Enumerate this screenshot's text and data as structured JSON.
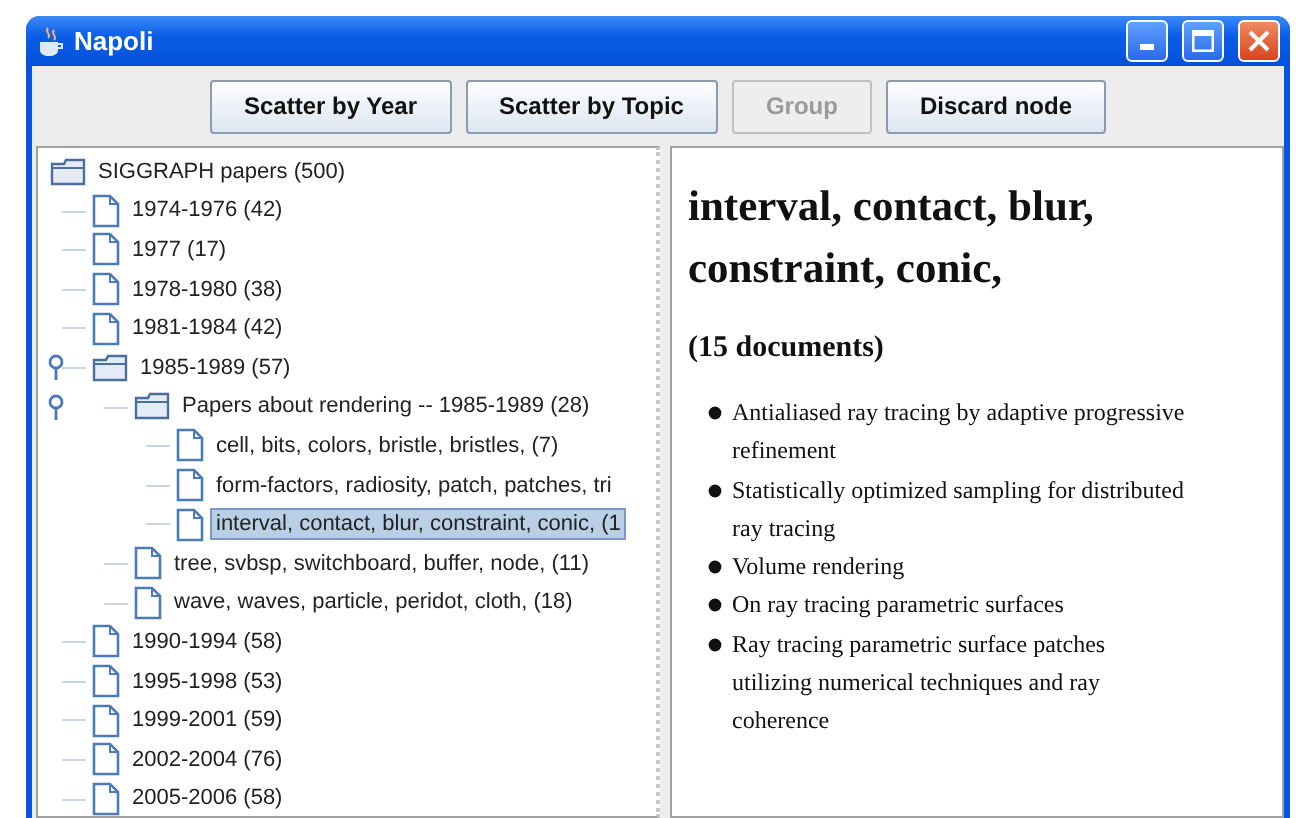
{
  "window": {
    "title": "Napoli"
  },
  "toolbar": [
    {
      "label": "Scatter by Year",
      "disabled": false
    },
    {
      "label": "Scatter by Topic",
      "disabled": false
    },
    {
      "label": "Group",
      "disabled": true
    },
    {
      "label": "Discard node",
      "disabled": false
    }
  ],
  "tree": {
    "label": "SIGGRAPH papers (500)",
    "selected": false,
    "children": [
      {
        "label": "1974-1976 (42)",
        "selected": false
      },
      {
        "label": "1977 (17)",
        "selected": false
      },
      {
        "label": "1978-1980 (38)",
        "selected": false
      },
      {
        "label": "1981-1984 (42)",
        "selected": false
      },
      {
        "label": "1985-1989 (57)",
        "expanded": true,
        "selected": false,
        "children": [
          {
            "label": "Papers about rendering -- 1985-1989 (28)",
            "expanded": true,
            "selected": false,
            "children": [
              {
                "label": "cell, bits, colors, bristle, bristles,  (7)",
                "selected": false
              },
              {
                "label": "form-factors, radiosity, patch, patches, tri",
                "selected": false
              },
              {
                "label": "interval, contact, blur, constraint, conic,  (1",
                "selected": true
              }
            ]
          },
          {
            "label": "tree, svbsp, switchboard, buffer, node,  (11)",
            "selected": false
          },
          {
            "label": "wave, waves, particle, peridot, cloth,  (18)",
            "selected": false
          }
        ]
      },
      {
        "label": "1990-1994 (58)",
        "selected": false
      },
      {
        "label": "1995-1998 (53)",
        "selected": false
      },
      {
        "label": "1999-2001 (59)",
        "selected": false
      },
      {
        "label": "2002-2004 (76)",
        "selected": false
      },
      {
        "label": "2005-2006 (58)",
        "selected": false
      }
    ]
  },
  "detail": {
    "heading": "interval, contact, blur, constraint, conic,",
    "count": "(15 documents)",
    "documents": [
      "Antialiased ray tracing by adaptive progressive refinement",
      "Statistically optimized sampling for distributed ray tracing",
      "Volume rendering",
      "On ray tracing parametric surfaces",
      "Ray tracing parametric surface patches utilizing numerical techniques and ray coherence"
    ]
  }
}
